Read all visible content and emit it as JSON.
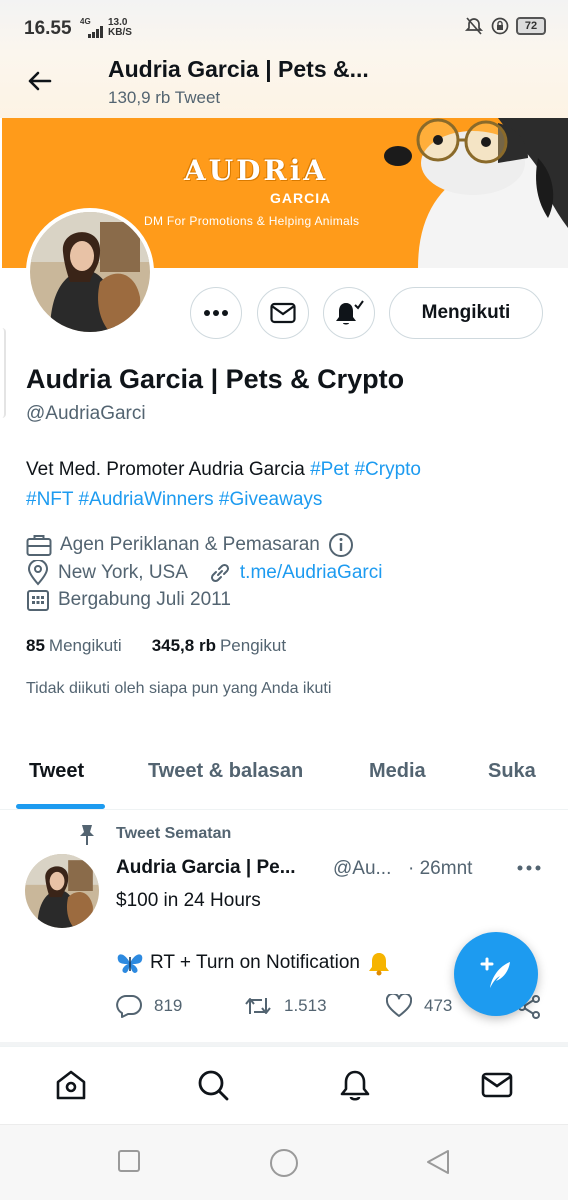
{
  "status_bar": {
    "time": "16.55",
    "network": "4G",
    "speed_value": "13.0",
    "speed_unit": "KB/S",
    "battery": "72"
  },
  "header": {
    "title": "Audria Garcia | Pets &...",
    "tweet_count": "130,9 rb Tweet"
  },
  "banner": {
    "brand_line1": "AUDRiA",
    "brand_line2": "GARCIA",
    "tagline": "DM For Promotions & Helping Animals"
  },
  "actions": {
    "follow_label": "Mengikuti"
  },
  "profile": {
    "name": "Audria Garcia | Pets & Crypto",
    "handle": "@AudriaGarci",
    "bio_text": "Vet Med. Promoter Audria Garcia ",
    "bio_tags": [
      "#Pet",
      "#Crypto",
      "#NFT",
      "#AudriaWinners",
      "#Giveaways"
    ],
    "category": "Agen Periklanan & Pemasaran",
    "location": "New York, USA",
    "link": "t.me/AudriaGarci",
    "joined": "Bergabung Juli 2011",
    "following_count": "85",
    "following_label": "Mengikuti",
    "followers_count": "345,8 rb",
    "followers_label": "Pengikut",
    "not_followed_text": "Tidak diikuti oleh siapa pun yang Anda ikuti"
  },
  "tabs": [
    {
      "label": "Tweet"
    },
    {
      "label": "Tweet & balasan"
    },
    {
      "label": "Media"
    },
    {
      "label": "Suka"
    }
  ],
  "pinned_tweet": {
    "pinned_label": "Tweet Sematan",
    "author": "Audria Garcia | Pe...",
    "handle": "@Au...",
    "time": "· 26mnt",
    "line1": "$100 in 24 Hours",
    "line2": "RT + Turn on Notification",
    "replies": "819",
    "retweets": "1.513",
    "likes": "473"
  },
  "colors": {
    "accent": "#1d9bf0",
    "banner": "#ff9b1a",
    "text_primary": "#0f1419",
    "text_secondary": "#536471"
  },
  "icons": [
    "back-arrow-icon",
    "more-icon",
    "mail-icon",
    "bell-notify-icon",
    "briefcase-icon",
    "info-icon",
    "location-icon",
    "link-icon",
    "calendar-icon",
    "pin-icon",
    "reply-icon",
    "retweet-icon",
    "like-icon",
    "share-icon",
    "compose-icon",
    "home-icon",
    "search-icon",
    "notifications-icon",
    "messages-icon"
  ]
}
